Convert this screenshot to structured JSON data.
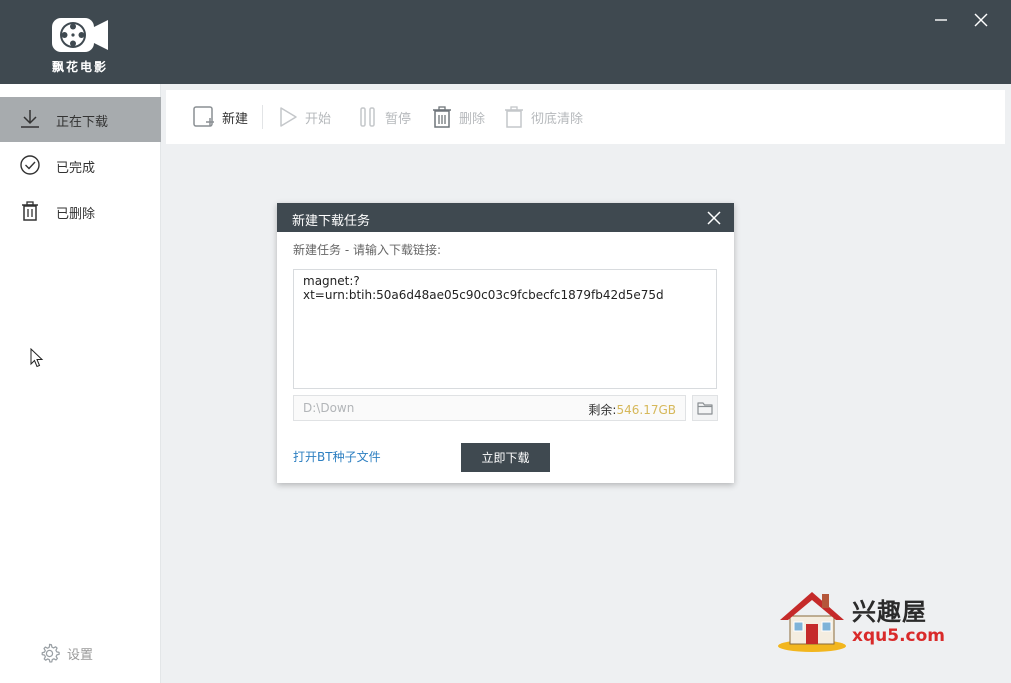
{
  "app": {
    "logo_text": "飘花电影"
  },
  "window": {
    "minimize_icon": "minimize-icon",
    "close_icon": "close-icon"
  },
  "sidebar": {
    "items": [
      {
        "label": "正在下载",
        "icon": "download-icon",
        "active": true
      },
      {
        "label": "已完成",
        "icon": "check-circle-icon",
        "active": false
      },
      {
        "label": "已删除",
        "icon": "trash-icon",
        "active": false
      }
    ],
    "settings_label": "设置"
  },
  "toolbar": {
    "new_label": "新建",
    "start_label": "开始",
    "pause_label": "暂停",
    "delete_label": "删除",
    "purge_label": "彻底清除"
  },
  "dialog": {
    "title": "新建下载任务",
    "prompt": "新建任务 - 请输入下载链接:",
    "link_value": "magnet:?xt=urn:btih:50a6d48ae05c90c03c9fcbecfc1879fb42d5e75d",
    "path_value": "D:\\Down",
    "remaining_label": "剩余:",
    "remaining_value": "546.17GB",
    "open_bt_label": "打开BT种子文件",
    "download_button": "立即下载"
  },
  "watermark": {
    "cn": "兴趣屋",
    "url": "xqu5.com"
  },
  "colors": {
    "titlebar": "#3f4950",
    "active_nav": "#a7abae",
    "link": "#2d7fc1",
    "remaining": "#d6b85a"
  }
}
